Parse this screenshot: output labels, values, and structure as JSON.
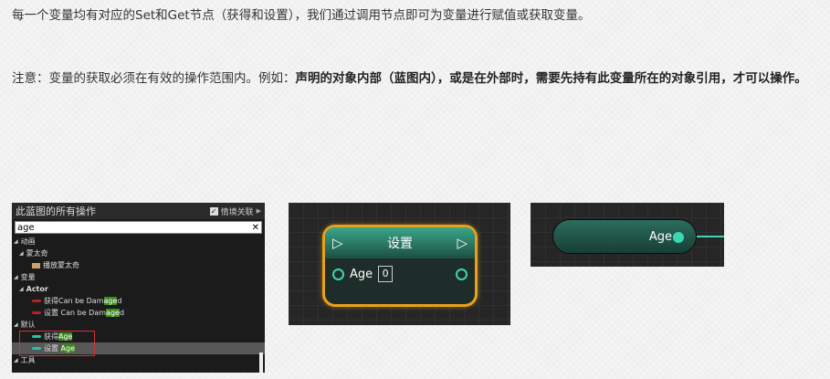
{
  "paragraphs": {
    "p1": "每一个变量均有对应的Set和Get节点（获得和设置），我们通过调用节点即可为变量进行赋值或获取变量。",
    "p2_plain": "注意：变量的获取必须在有效的操作范围内。例如：",
    "p2_bold": "声明的对象内部（蓝图内），或是在外部时，需要先持有此变量所在的对象引用，才可以操作。"
  },
  "action_menu": {
    "title": "此蓝图的所有操作",
    "context_label": "情境关联",
    "context_checked": true,
    "search_value": "age",
    "clear_glyph": "✕",
    "categories": {
      "animation": "动画",
      "montage": "蒙太奇",
      "play_montage": "播放蒙太奇",
      "variables": "变量",
      "actor": "Actor",
      "default": "默认",
      "tools": "工具"
    },
    "items": {
      "get_can_be_damaged_prefix": "获得Can be Dam",
      "get_can_be_damaged_match": "age",
      "get_can_be_damaged_suffix": "d",
      "set_can_be_damaged_prefix": "设置 Can be Dam",
      "set_can_be_damaged_match": "age",
      "set_can_be_damaged_suffix": "d",
      "get_age_prefix": "获得",
      "get_age_match": "Age",
      "set_age_prefix": "设置 ",
      "set_age_match": "Age"
    }
  },
  "set_node": {
    "title": "设置",
    "pin_label": "Age",
    "value": "0",
    "exec_glyph": "▷"
  },
  "get_node": {
    "label": "Age"
  },
  "colors": {
    "node_border": "#e8a11c",
    "node_header": "#3aa58a",
    "pin": "#3ad7b0",
    "highlight": "#3c8a1e",
    "selection_box": "#d23333"
  }
}
